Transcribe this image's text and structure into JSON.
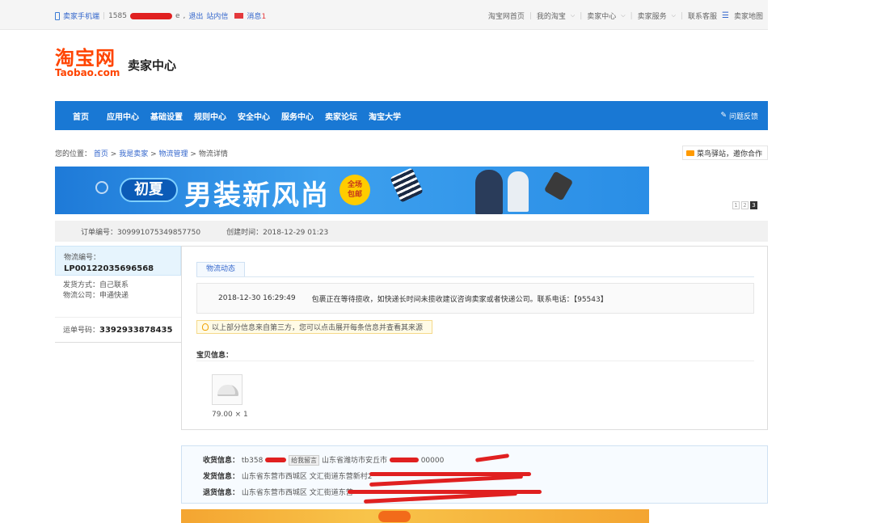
{
  "topbar": {
    "seller_phone_label": "卖家手机端",
    "account_prefix": "1585",
    "account_suffix": "e",
    "logout": "退出",
    "inbox": "站内信",
    "messages_label": "消息",
    "messages_count": "1",
    "links": [
      "淘宝网首页",
      "我的淘宝",
      "卖家中心",
      "卖家服务",
      "联系客服",
      "卖家地图"
    ]
  },
  "logo": {
    "cn": "淘宝网",
    "en": "Taobao.com",
    "sub": "卖家中心"
  },
  "nav": {
    "items": [
      "首页",
      "应用中心",
      "基础设置",
      "规则中心",
      "安全中心",
      "服务中心",
      "卖家论坛",
      "淘宝大学"
    ],
    "feedback": "问题反馈"
  },
  "breadcrumb": {
    "prefix": "您的位置：",
    "links": [
      "首页",
      "我是卖家",
      "物流管理"
    ],
    "current": "物流详情",
    "separator": ">"
  },
  "partner": {
    "label": "菜鸟驿站，邀你合作"
  },
  "banner": {
    "tag": "初夏",
    "title": "男装新风尚",
    "badge_line1": "全场",
    "badge_line2": "包邮",
    "pages": [
      "1",
      "2",
      "3"
    ],
    "active_page": "3"
  },
  "order": {
    "number_label": "订单编号：",
    "number": "309991075349857750",
    "created_label": "创建时间：",
    "created": "2018-12-29 01:23"
  },
  "logistics": {
    "no_label": "物流编号：",
    "no": "LP00122035696568",
    "ship_method": "发货方式：自己联系",
    "company": "物流公司：申通快递",
    "waybill_label": "运单号码：",
    "waybill": "3392933878435"
  },
  "tracking": {
    "tab": "物流动态",
    "time": "2018-12-30 16:29:49",
    "message": "包裹正在等待揽收，如快递长时间未揽收建议咨询卖家或者快递公司。联系电话：【95543】",
    "note": "以上部分信息来自第三方，您可以点击展开每条信息并查看其来源"
  },
  "goods": {
    "label": "宝贝信息：",
    "price": "79.00 × 1"
  },
  "address": {
    "receiver_label": "收货信息：",
    "receiver_prefix": "tb358",
    "message_button": "给我留言",
    "receiver_addr": "山东省潍坊市安丘市",
    "postcode": "00000",
    "sender_label": "发货信息：",
    "sender_addr": "山东省东营市西城区 文汇街道东营新村2",
    "return_label": "退货信息：",
    "return_addr": "山东省东营市西城区 文汇街道东营"
  },
  "colors": {
    "nav": "#1978d4",
    "brand": "#ff4400",
    "redact": "#e02020"
  }
}
